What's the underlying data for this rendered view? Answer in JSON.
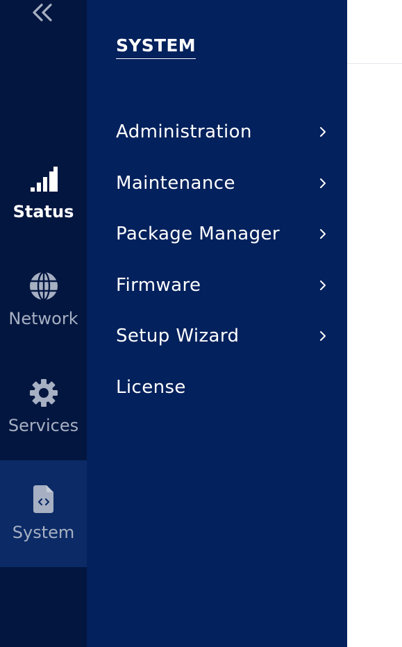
{
  "rail": {
    "items": [
      {
        "id": "status",
        "label": "Status",
        "icon": "signal-bars-icon",
        "active": true
      },
      {
        "id": "network",
        "label": "Network",
        "icon": "globe-icon",
        "active": false
      },
      {
        "id": "services",
        "label": "Services",
        "icon": "gear-icon",
        "active": false
      },
      {
        "id": "system",
        "label": "System",
        "icon": "file-code-icon",
        "active": false,
        "selected": true
      }
    ]
  },
  "panel": {
    "title": "SYSTEM",
    "items": [
      {
        "label": "Administration",
        "has_submenu": true
      },
      {
        "label": "Maintenance",
        "has_submenu": true
      },
      {
        "label": "Package Manager",
        "has_submenu": true
      },
      {
        "label": "Firmware",
        "has_submenu": true
      },
      {
        "label": "Setup Wizard",
        "has_submenu": true
      },
      {
        "label": "License",
        "has_submenu": false
      }
    ]
  },
  "colors": {
    "rail_bg": "#031640",
    "panel_bg": "#03215c",
    "selected_rail_bg": "#0b2a66",
    "muted_text": "#a7b0c2",
    "text": "#ffffff"
  }
}
